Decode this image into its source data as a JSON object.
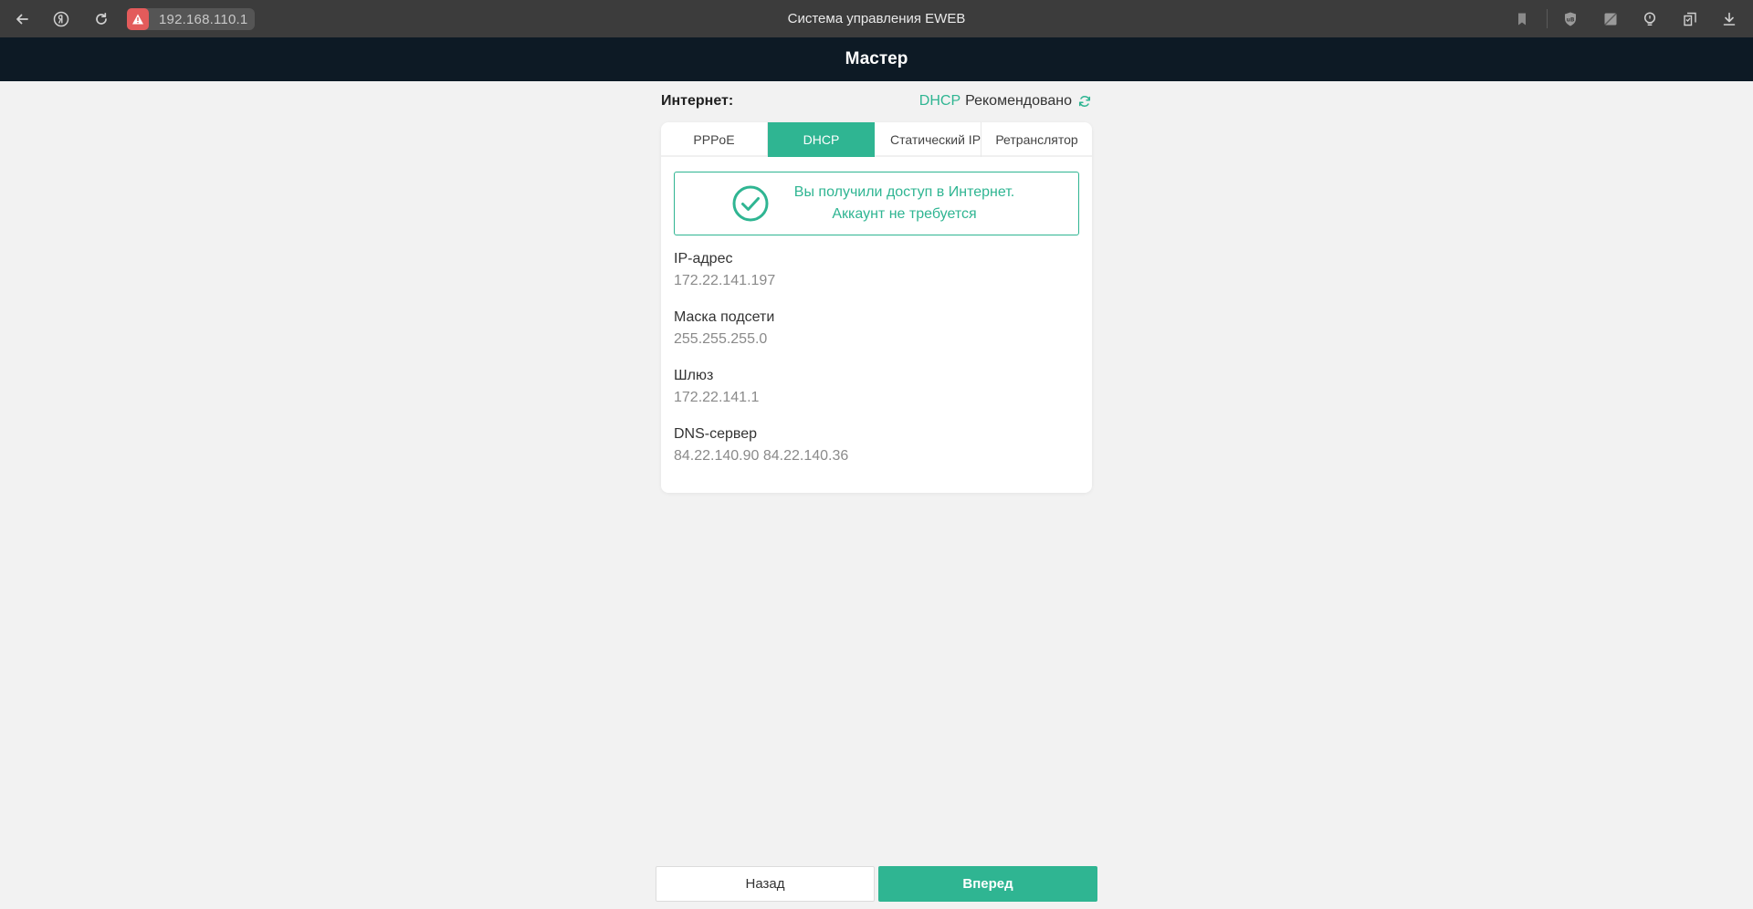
{
  "browser": {
    "url": "192.168.110.1",
    "page_title": "Система управления EWEB"
  },
  "header": {
    "title": "Мастер"
  },
  "internet": {
    "label": "Интернет:",
    "detected_protocol": "DHCP",
    "recommend_text": "Рекомендовано"
  },
  "tabs": [
    {
      "label": "PPPoE",
      "active": false
    },
    {
      "label": "DHCP",
      "active": true
    },
    {
      "label": "Статический IP",
      "active": false
    },
    {
      "label": "Ретранслятор",
      "active": false
    }
  ],
  "status": {
    "line1": "Вы получили доступ в Интернет.",
    "line2": "Аккаунт не требуется"
  },
  "info": [
    {
      "label": "IP-адрес",
      "value": "172.22.141.197"
    },
    {
      "label": "Маска подсети",
      "value": "255.255.255.0"
    },
    {
      "label": "Шлюз",
      "value": "172.22.141.1"
    },
    {
      "label": "DNS-сервер",
      "value": "84.22.140.90 84.22.140.36"
    }
  ],
  "buttons": {
    "back": "Назад",
    "next": "Вперед"
  },
  "colors": {
    "accent": "#2fb592",
    "header_bg": "#0d1a25",
    "page_bg": "#f2f2f2"
  },
  "icons": [
    "back-arrow-icon",
    "yandex-icon",
    "reload-icon",
    "warning-icon",
    "bookmark-icon",
    "shield-extension-icon",
    "extension-icon",
    "lightbulb-icon",
    "collections-icon",
    "download-icon",
    "refresh-icon",
    "check-circle-icon"
  ]
}
